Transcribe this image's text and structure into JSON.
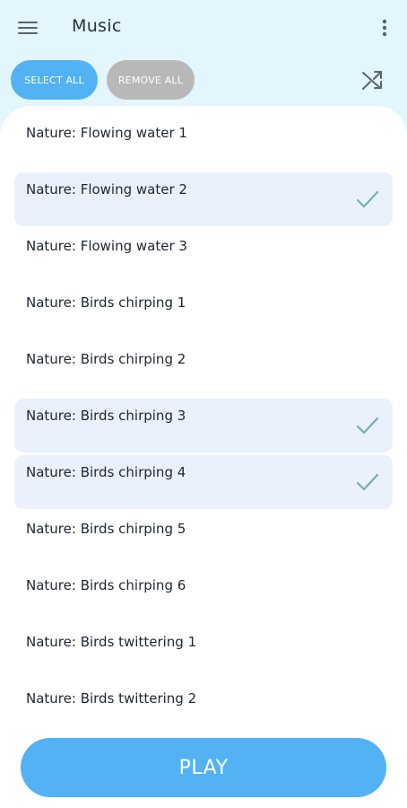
{
  "app_bar": {
    "title": "Music",
    "menu_icon": "hamburger-menu-icon",
    "overflow_icon": "more-vert-icon"
  },
  "actions": {
    "select_all_label": "SELECT ALL",
    "remove_all_label": "REMOVE ALL",
    "shuffle_icon": "shuffle-icon"
  },
  "tracks": [
    {
      "label": "Nature: Flowing water 1",
      "selected": false
    },
    {
      "label": "Nature: Flowing water 2",
      "selected": true
    },
    {
      "label": "Nature: Flowing water 3",
      "selected": false
    },
    {
      "label": "Nature: Birds chirping 1",
      "selected": false
    },
    {
      "label": "Nature: Birds chirping 2",
      "selected": false
    },
    {
      "label": "Nature: Birds chirping 3",
      "selected": true
    },
    {
      "label": "Nature: Birds chirping 4",
      "selected": true
    },
    {
      "label": "Nature: Birds chirping 5",
      "selected": false
    },
    {
      "label": "Nature: Birds chirping 6",
      "selected": false
    },
    {
      "label": "Nature: Birds twittering 1",
      "selected": false
    },
    {
      "label": "Nature: Birds twittering 2",
      "selected": false
    }
  ],
  "play_label": "PLAY",
  "colors": {
    "accent": "#52b2f3",
    "header_bg": "#e3f5fd",
    "selected_row_bg": "#eaf1fd",
    "check_color": "#6fb3ad",
    "remove_all_bg": "#b8b8b8"
  }
}
